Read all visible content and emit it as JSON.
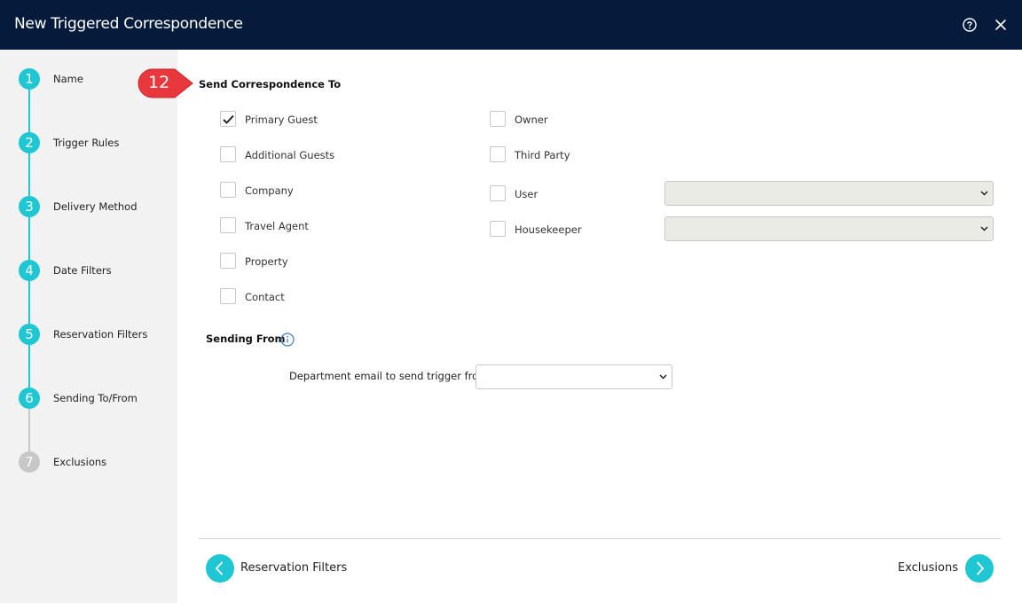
{
  "window": {
    "title": "New Triggered Correspondence"
  },
  "icons": {
    "help": "help-circle-icon",
    "close": "close-x-icon",
    "info": "info-icon",
    "chevron": "chevron-down-icon",
    "back": "chevron-left-icon",
    "next": "chevron-right-icon"
  },
  "colors": {
    "titlebar": "#061b3b",
    "accent": "#1fc7d4",
    "disabled_step": "#c7c7c7",
    "callout": "#e8383d"
  },
  "steps": [
    {
      "number": "1",
      "label": "Name",
      "enabled": true
    },
    {
      "number": "2",
      "label": "Trigger Rules",
      "enabled": true
    },
    {
      "number": "3",
      "label": "Delivery Method",
      "enabled": true
    },
    {
      "number": "4",
      "label": "Date Filters",
      "enabled": true
    },
    {
      "number": "5",
      "label": "Reservation Filters",
      "enabled": true
    },
    {
      "number": "6",
      "label": "Sending To/From",
      "enabled": true
    },
    {
      "number": "7",
      "label": "Exclusions",
      "enabled": false
    }
  ],
  "callout": {
    "number": "12"
  },
  "send_to": {
    "title": "Send Correspondence To",
    "left_options": [
      {
        "label": "Primary Guest",
        "checked": true
      },
      {
        "label": "Additional Guests",
        "checked": false
      },
      {
        "label": "Company",
        "checked": false
      },
      {
        "label": "Travel Agent",
        "checked": false
      },
      {
        "label": "Property",
        "checked": false
      },
      {
        "label": "Contact",
        "checked": false
      }
    ],
    "right_options": [
      {
        "label": "Owner",
        "checked": false
      },
      {
        "label": "Third Party",
        "checked": false
      },
      {
        "label": "User",
        "checked": false,
        "select_value": ""
      },
      {
        "label": "Housekeeper",
        "checked": false,
        "select_value": ""
      }
    ]
  },
  "sending_from": {
    "title": "Sending From",
    "department_label": "Department email to send trigger from",
    "department_value": ""
  },
  "footer": {
    "back_label": "Reservation Filters",
    "next_label": "Exclusions"
  }
}
